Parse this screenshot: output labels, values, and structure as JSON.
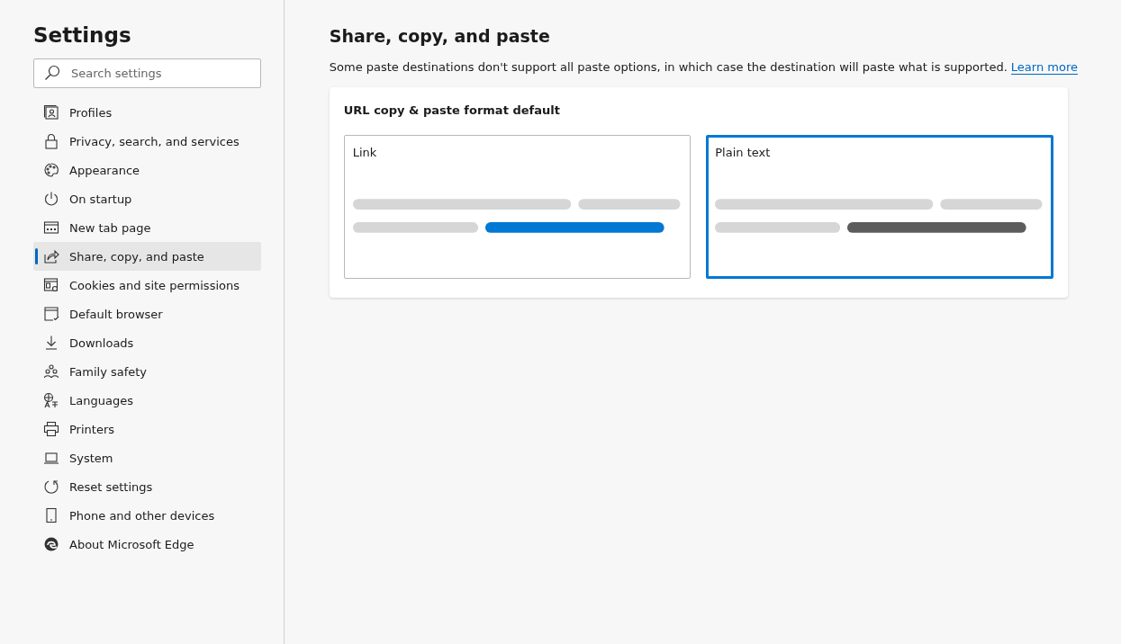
{
  "sidebar": {
    "title": "Settings",
    "search": {
      "placeholder": "Search settings"
    },
    "items": [
      {
        "label": "Profiles",
        "selected": false
      },
      {
        "label": "Privacy, search, and services",
        "selected": false
      },
      {
        "label": "Appearance",
        "selected": false
      },
      {
        "label": "On startup",
        "selected": false
      },
      {
        "label": "New tab page",
        "selected": false
      },
      {
        "label": "Share, copy, and paste",
        "selected": true
      },
      {
        "label": "Cookies and site permissions",
        "selected": false
      },
      {
        "label": "Default browser",
        "selected": false
      },
      {
        "label": "Downloads",
        "selected": false
      },
      {
        "label": "Family safety",
        "selected": false
      },
      {
        "label": "Languages",
        "selected": false
      },
      {
        "label": "Printers",
        "selected": false
      },
      {
        "label": "System",
        "selected": false
      },
      {
        "label": "Reset settings",
        "selected": false
      },
      {
        "label": "Phone and other devices",
        "selected": false
      },
      {
        "label": "About Microsoft Edge",
        "selected": false
      }
    ]
  },
  "main": {
    "title": "Share, copy, and paste",
    "description": "Some paste destinations don't support all paste options, in which case the destination will paste what is supported.",
    "link": "Learn more",
    "card": {
      "title": "URL copy & paste format default",
      "options": [
        {
          "label": "Link",
          "kind": "link",
          "selected": false
        },
        {
          "label": "Plain text",
          "kind": "plain",
          "selected": true
        }
      ]
    }
  }
}
